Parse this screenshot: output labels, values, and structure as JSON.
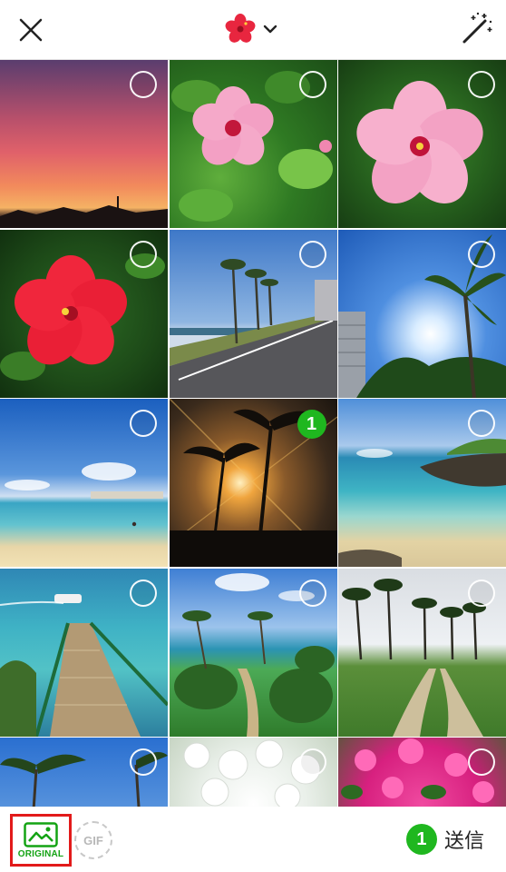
{
  "header": {
    "close_icon": "close-icon",
    "album_icon": "hibiscus-icon",
    "dropdown_icon": "chevron-down-icon",
    "magic_icon": "magic-wand-icon"
  },
  "photos": [
    {
      "name": "sunset-sky",
      "selected": false
    },
    {
      "name": "pink-hibiscus-leaves",
      "selected": false
    },
    {
      "name": "pink-hibiscus-large",
      "selected": false
    },
    {
      "name": "red-hibiscus",
      "selected": false
    },
    {
      "name": "palm-road",
      "selected": false
    },
    {
      "name": "palm-sky-sun",
      "selected": false
    },
    {
      "name": "beach-blue-sky",
      "selected": false
    },
    {
      "name": "sunset-palms",
      "selected": true,
      "order": "1"
    },
    {
      "name": "rocky-beach",
      "selected": false
    },
    {
      "name": "pier-boat",
      "selected": false
    },
    {
      "name": "garden-path-sea",
      "selected": false
    },
    {
      "name": "palm-lawn-path",
      "selected": false
    },
    {
      "name": "palms-blue-sky",
      "selected": false
    },
    {
      "name": "white-flowers",
      "selected": false
    },
    {
      "name": "pink-bougainvillea",
      "selected": false
    }
  ],
  "footer": {
    "original_label": "ORIGINAL",
    "gif_label": "GIF",
    "send_count": "1",
    "send_label": "送信"
  },
  "colors": {
    "accent_green": "#1fb71f",
    "highlight_red": "#e21a1a"
  }
}
